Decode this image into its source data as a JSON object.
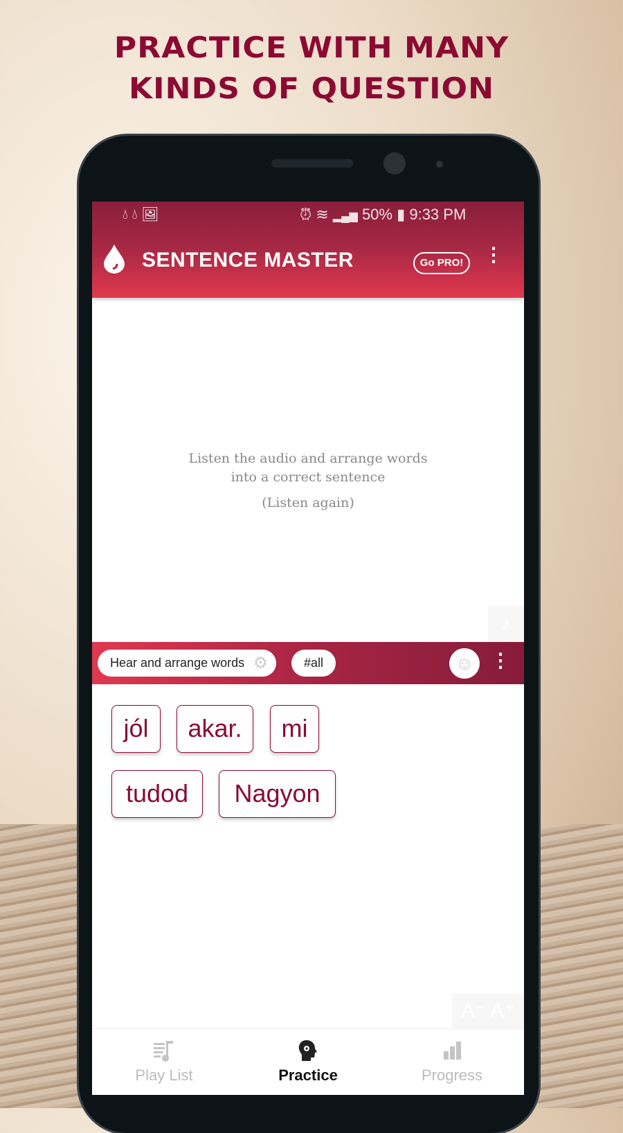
{
  "promo": {
    "line1": "PRACTICE WITH MANY",
    "line2": "KINDS OF QUESTION"
  },
  "status_bar": {
    "battery": "50%",
    "time": "9:33 PM"
  },
  "app_bar": {
    "title": "SENTENCE MASTER",
    "go_pro": "Go PRO!"
  },
  "question": {
    "instruction_line1": "Listen the audio and arrange words",
    "instruction_line2": "into a correct sentence",
    "listen_again": "(Listen again)"
  },
  "toolbar": {
    "mode": "Hear and arrange words",
    "tag": "#all"
  },
  "words": [
    "jól",
    "akar.",
    "mi",
    "tudod",
    "Nagyon"
  ],
  "font_controls": {
    "decrease": "A⁻",
    "increase": "A⁺"
  },
  "nav": [
    {
      "label": "Play List",
      "icon": "playlist-icon"
    },
    {
      "label": "Practice",
      "icon": "head-gear-icon",
      "active": true
    },
    {
      "label": "Progress",
      "icon": "bar-chart-icon"
    }
  ],
  "colors": {
    "brand": "#8b0a33",
    "accent": "#e1384f"
  }
}
